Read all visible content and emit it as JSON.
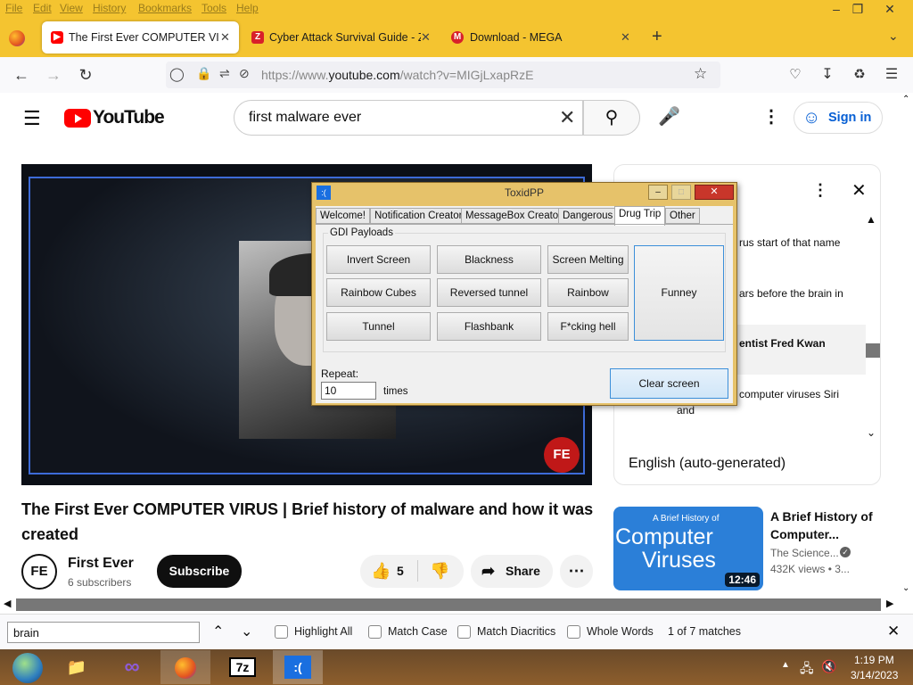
{
  "browser": {
    "menu": [
      "File",
      "Edit",
      "View",
      "History",
      "Bookmarks",
      "Tools",
      "Help"
    ],
    "tabs": [
      {
        "title": "The First Ever COMPUTER VIRU"
      },
      {
        "title": "Cyber Attack Survival Guide - Z"
      },
      {
        "title": "Download - MEGA"
      }
    ],
    "url_prefix": "https://www.",
    "url_domain": "youtube.com",
    "url_path": "/watch?v=MIGjLxapRzE"
  },
  "youtube": {
    "logo_text": "YouTube",
    "search_query": "first malware ever",
    "sign_in": "Sign in",
    "video_title": "The First Ever COMPUTER VIRUS | Brief history of malware and how it was created",
    "channel_name": "First Ever",
    "channel_initials": "FE",
    "subscribers": "6 subscribers",
    "subscribe_label": "Subscribe",
    "likes": "5",
    "share_label": "Share",
    "transcript_lines": [
      "rus start of that name",
      "ars before the brain in",
      "entist Fred Kwan",
      "computer viruses Siri",
      "and"
    ],
    "transcript_language": "English (auto-generated)",
    "related": {
      "thumb_line1": "A Brief History of",
      "thumb_line2": "Computer",
      "thumb_line3": "Viruses",
      "duration": "12:46",
      "title": "A Brief History of Computer...",
      "channel": "The Science...",
      "views": "432K views • 3..."
    }
  },
  "findbar": {
    "query": "brain",
    "highlight_all": "Highlight All",
    "match_case": "Match Case",
    "match_diacritics": "Match Diacritics",
    "whole_words": "Whole Words",
    "result": "1 of 7 matches"
  },
  "toxidpp": {
    "title": "ToxidPP",
    "tabs": [
      "Welcome!",
      "Notification Creator",
      "MessageBox Creator",
      "Dangerous",
      "Drug Trip",
      "Other"
    ],
    "group_label": "GDI Payloads",
    "buttons": [
      "Invert Screen",
      "Blackness",
      "Screen Melting",
      "Rainbow Cubes",
      "Reversed tunnel",
      "Rainbow",
      "Tunnel",
      "Flashbank",
      "F*cking hell",
      "Funney"
    ],
    "repeat_label": "Repeat:",
    "repeat_value": "10",
    "times_label": "times",
    "clear_label": "Clear screen"
  },
  "taskbar": {
    "time": "1:19 PM",
    "date": "3/14/2023",
    "items": [
      "windows-orb",
      "file-explorer",
      "visual-studio",
      "firefox",
      "7zip",
      "toxidpp"
    ]
  },
  "colors": {
    "chrome": "#f4c430",
    "yt_red": "#ff0000",
    "link_blue": "#065fd4"
  }
}
